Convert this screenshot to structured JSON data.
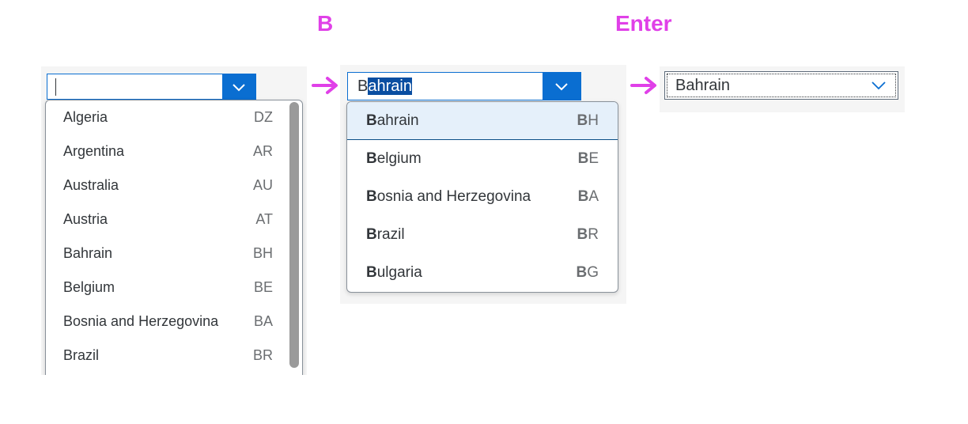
{
  "steps": {
    "key_b": "B",
    "key_enter": "Enter"
  },
  "colors": {
    "accent": "#0a6ed1",
    "annotation": "#e040e8",
    "highlight_bg": "#e5f0fa"
  },
  "panel1": {
    "input_value": "",
    "items": [
      {
        "name": "Algeria",
        "code": "DZ"
      },
      {
        "name": "Argentina",
        "code": "AR"
      },
      {
        "name": "Australia",
        "code": "AU"
      },
      {
        "name": "Austria",
        "code": "AT"
      },
      {
        "name": "Bahrain",
        "code": "BH"
      },
      {
        "name": "Belgium",
        "code": "BE"
      },
      {
        "name": "Bosnia and Herzegovina",
        "code": "BA"
      },
      {
        "name": "Brazil",
        "code": "BR"
      }
    ]
  },
  "panel2": {
    "typed": "B",
    "autocomplete": "ahrain",
    "items": [
      {
        "bold": "B",
        "rest": "ahrain",
        "code_bold": "B",
        "code_rest": "H"
      },
      {
        "bold": "B",
        "rest": "elgium",
        "code_bold": "B",
        "code_rest": "E"
      },
      {
        "bold": "B",
        "rest": "osnia and Herzegovina",
        "code_bold": "B",
        "code_rest": "A"
      },
      {
        "bold": "B",
        "rest": "razil",
        "code_bold": "B",
        "code_rest": "R"
      },
      {
        "bold": "B",
        "rest": "ulgaria",
        "code_bold": "B",
        "code_rest": "G"
      }
    ]
  },
  "panel3": {
    "value": "Bahrain"
  }
}
